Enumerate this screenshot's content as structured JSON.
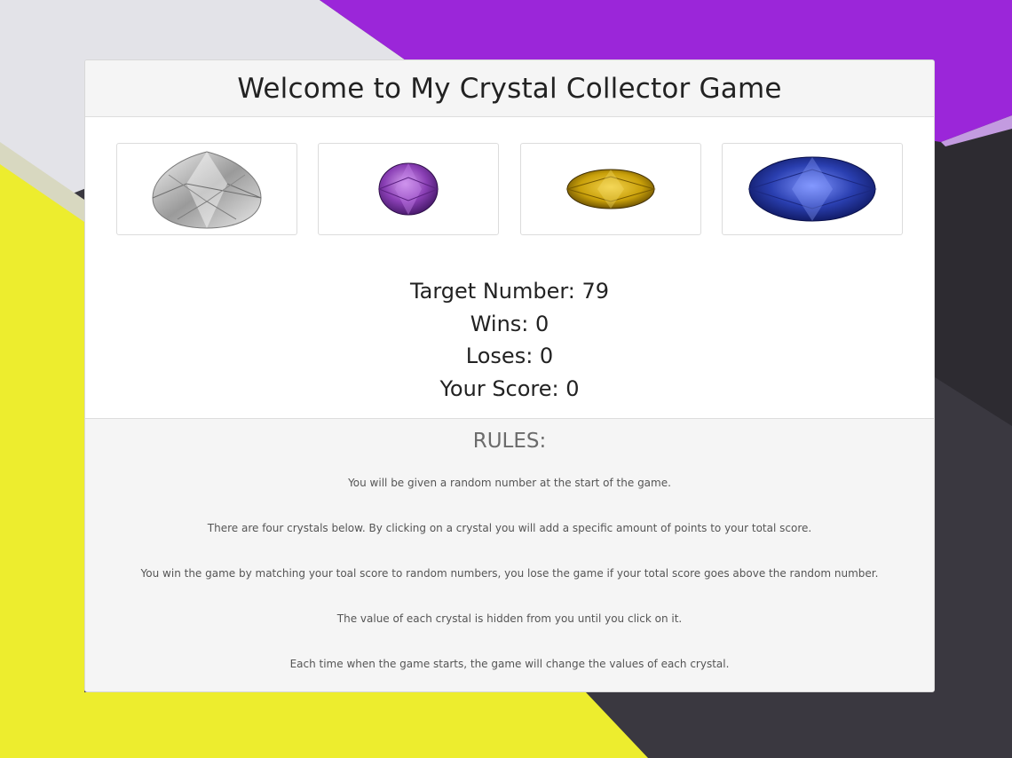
{
  "header": {
    "title": "Welcome to My Crystal Collector Game"
  },
  "crystals": [
    {
      "name": "diamond",
      "color": "#d9d9d9"
    },
    {
      "name": "amethyst",
      "color": "#8a3fb5"
    },
    {
      "name": "citrine",
      "color": "#c9a00a"
    },
    {
      "name": "sapphire",
      "color": "#2a3fb0"
    }
  ],
  "stats": {
    "target": "Target Number: 79",
    "wins": "Wins: 0",
    "loses": "Loses: 0",
    "score": "Your Score: 0"
  },
  "rules": {
    "title": "RULES:",
    "items": [
      "You will be given a random number at the start of the game.",
      "There are four crystals below. By clicking on a crystal you will add a specific amount of points to your total score.",
      "You win the game by matching your toal score to random numbers, you lose the game if your total score goes above the random number.",
      "The value of each crystal is hidden from you until you click on it.",
      "Each time when the game starts, the game will change the values of each crystal."
    ]
  },
  "colors": {
    "background_purple": "#9b26d9",
    "background_yellow": "#eeee30",
    "background_dark": "#2c2a30",
    "background_light": "#e2e2e6"
  }
}
